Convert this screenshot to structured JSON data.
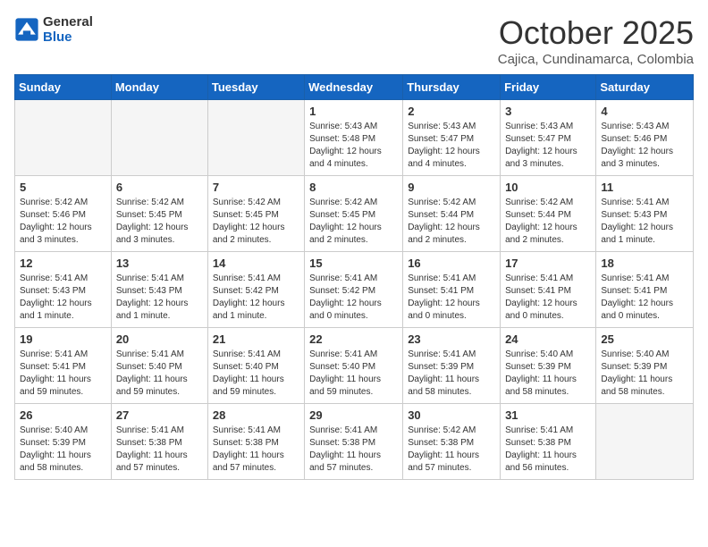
{
  "header": {
    "logo_line1": "General",
    "logo_line2": "Blue",
    "month_title": "October 2025",
    "location": "Cajica, Cundinamarca, Colombia"
  },
  "weekdays": [
    "Sunday",
    "Monday",
    "Tuesday",
    "Wednesday",
    "Thursday",
    "Friday",
    "Saturday"
  ],
  "weeks": [
    [
      {
        "day": "",
        "empty": true
      },
      {
        "day": "",
        "empty": true
      },
      {
        "day": "",
        "empty": true
      },
      {
        "day": "1",
        "sunrise": "5:43 AM",
        "sunset": "5:48 PM",
        "daylight": "12 hours and 4 minutes."
      },
      {
        "day": "2",
        "sunrise": "5:43 AM",
        "sunset": "5:47 PM",
        "daylight": "12 hours and 4 minutes."
      },
      {
        "day": "3",
        "sunrise": "5:43 AM",
        "sunset": "5:47 PM",
        "daylight": "12 hours and 3 minutes."
      },
      {
        "day": "4",
        "sunrise": "5:43 AM",
        "sunset": "5:46 PM",
        "daylight": "12 hours and 3 minutes."
      }
    ],
    [
      {
        "day": "5",
        "sunrise": "5:42 AM",
        "sunset": "5:46 PM",
        "daylight": "12 hours and 3 minutes."
      },
      {
        "day": "6",
        "sunrise": "5:42 AM",
        "sunset": "5:45 PM",
        "daylight": "12 hours and 3 minutes."
      },
      {
        "day": "7",
        "sunrise": "5:42 AM",
        "sunset": "5:45 PM",
        "daylight": "12 hours and 2 minutes."
      },
      {
        "day": "8",
        "sunrise": "5:42 AM",
        "sunset": "5:45 PM",
        "daylight": "12 hours and 2 minutes."
      },
      {
        "day": "9",
        "sunrise": "5:42 AM",
        "sunset": "5:44 PM",
        "daylight": "12 hours and 2 minutes."
      },
      {
        "day": "10",
        "sunrise": "5:42 AM",
        "sunset": "5:44 PM",
        "daylight": "12 hours and 2 minutes."
      },
      {
        "day": "11",
        "sunrise": "5:41 AM",
        "sunset": "5:43 PM",
        "daylight": "12 hours and 1 minute."
      }
    ],
    [
      {
        "day": "12",
        "sunrise": "5:41 AM",
        "sunset": "5:43 PM",
        "daylight": "12 hours and 1 minute."
      },
      {
        "day": "13",
        "sunrise": "5:41 AM",
        "sunset": "5:43 PM",
        "daylight": "12 hours and 1 minute."
      },
      {
        "day": "14",
        "sunrise": "5:41 AM",
        "sunset": "5:42 PM",
        "daylight": "12 hours and 1 minute."
      },
      {
        "day": "15",
        "sunrise": "5:41 AM",
        "sunset": "5:42 PM",
        "daylight": "12 hours and 0 minutes."
      },
      {
        "day": "16",
        "sunrise": "5:41 AM",
        "sunset": "5:41 PM",
        "daylight": "12 hours and 0 minutes."
      },
      {
        "day": "17",
        "sunrise": "5:41 AM",
        "sunset": "5:41 PM",
        "daylight": "12 hours and 0 minutes."
      },
      {
        "day": "18",
        "sunrise": "5:41 AM",
        "sunset": "5:41 PM",
        "daylight": "12 hours and 0 minutes."
      }
    ],
    [
      {
        "day": "19",
        "sunrise": "5:41 AM",
        "sunset": "5:41 PM",
        "daylight": "11 hours and 59 minutes."
      },
      {
        "day": "20",
        "sunrise": "5:41 AM",
        "sunset": "5:40 PM",
        "daylight": "11 hours and 59 minutes."
      },
      {
        "day": "21",
        "sunrise": "5:41 AM",
        "sunset": "5:40 PM",
        "daylight": "11 hours and 59 minutes."
      },
      {
        "day": "22",
        "sunrise": "5:41 AM",
        "sunset": "5:40 PM",
        "daylight": "11 hours and 59 minutes."
      },
      {
        "day": "23",
        "sunrise": "5:41 AM",
        "sunset": "5:39 PM",
        "daylight": "11 hours and 58 minutes."
      },
      {
        "day": "24",
        "sunrise": "5:40 AM",
        "sunset": "5:39 PM",
        "daylight": "11 hours and 58 minutes."
      },
      {
        "day": "25",
        "sunrise": "5:40 AM",
        "sunset": "5:39 PM",
        "daylight": "11 hours and 58 minutes."
      }
    ],
    [
      {
        "day": "26",
        "sunrise": "5:40 AM",
        "sunset": "5:39 PM",
        "daylight": "11 hours and 58 minutes."
      },
      {
        "day": "27",
        "sunrise": "5:41 AM",
        "sunset": "5:38 PM",
        "daylight": "11 hours and 57 minutes."
      },
      {
        "day": "28",
        "sunrise": "5:41 AM",
        "sunset": "5:38 PM",
        "daylight": "11 hours and 57 minutes."
      },
      {
        "day": "29",
        "sunrise": "5:41 AM",
        "sunset": "5:38 PM",
        "daylight": "11 hours and 57 minutes."
      },
      {
        "day": "30",
        "sunrise": "5:42 AM",
        "sunset": "5:38 PM",
        "daylight": "11 hours and 57 minutes."
      },
      {
        "day": "31",
        "sunrise": "5:41 AM",
        "sunset": "5:38 PM",
        "daylight": "11 hours and 56 minutes."
      },
      {
        "day": "",
        "empty": true
      }
    ]
  ]
}
